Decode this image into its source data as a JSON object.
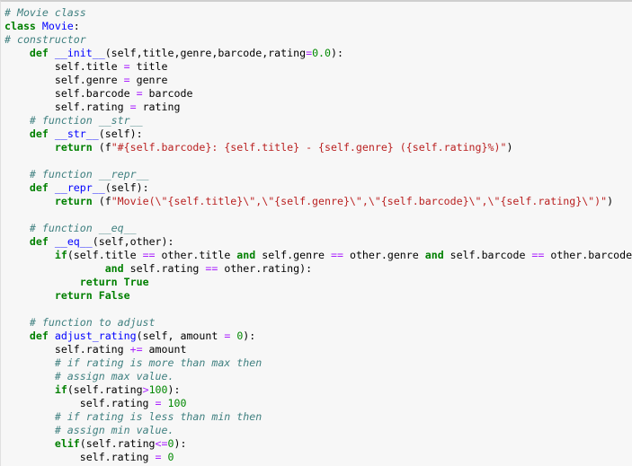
{
  "editor": {
    "language": "python",
    "colors": {
      "background": "#f7f7f7",
      "comment": "#408080",
      "keyword": "#008000",
      "definition": "#0000ff",
      "string": "#ba2121",
      "number": "#008800",
      "operator": "#aa22ff"
    },
    "lines": [
      [
        {
          "t": "comment",
          "v": "# Movie class"
        }
      ],
      [
        {
          "t": "keyword",
          "v": "class"
        },
        {
          "t": "plain",
          "v": " "
        },
        {
          "t": "def",
          "v": "Movie"
        },
        {
          "t": "plain",
          "v": ":"
        }
      ],
      [
        {
          "t": "comment",
          "v": "# constructor"
        }
      ],
      [
        {
          "t": "plain",
          "v": "    "
        },
        {
          "t": "keyword",
          "v": "def"
        },
        {
          "t": "plain",
          "v": " "
        },
        {
          "t": "def",
          "v": "__init__"
        },
        {
          "t": "plain",
          "v": "(self,title,genre,barcode,rating"
        },
        {
          "t": "op",
          "v": "="
        },
        {
          "t": "number",
          "v": "0.0"
        },
        {
          "t": "plain",
          "v": "):"
        }
      ],
      [
        {
          "t": "plain",
          "v": "        self.title "
        },
        {
          "t": "op",
          "v": "="
        },
        {
          "t": "plain",
          "v": " title"
        }
      ],
      [
        {
          "t": "plain",
          "v": "        self.genre "
        },
        {
          "t": "op",
          "v": "="
        },
        {
          "t": "plain",
          "v": " genre"
        }
      ],
      [
        {
          "t": "plain",
          "v": "        self.barcode "
        },
        {
          "t": "op",
          "v": "="
        },
        {
          "t": "plain",
          "v": " barcode"
        }
      ],
      [
        {
          "t": "plain",
          "v": "        self.rating "
        },
        {
          "t": "op",
          "v": "="
        },
        {
          "t": "plain",
          "v": " rating"
        }
      ],
      [
        {
          "t": "plain",
          "v": "    "
        },
        {
          "t": "comment",
          "v": "# function __str__"
        }
      ],
      [
        {
          "t": "plain",
          "v": "    "
        },
        {
          "t": "keyword",
          "v": "def"
        },
        {
          "t": "plain",
          "v": " "
        },
        {
          "t": "def",
          "v": "__str__"
        },
        {
          "t": "plain",
          "v": "(self):"
        }
      ],
      [
        {
          "t": "plain",
          "v": "        "
        },
        {
          "t": "keyword",
          "v": "return"
        },
        {
          "t": "plain",
          "v": " (f"
        },
        {
          "t": "string",
          "v": "\"#{self.barcode}: {self.title} - {self.genre} ({self.rating}%)\""
        },
        {
          "t": "plain",
          "v": ")"
        }
      ],
      [
        {
          "t": "plain",
          "v": ""
        }
      ],
      [
        {
          "t": "plain",
          "v": "    "
        },
        {
          "t": "comment",
          "v": "# function __repr__"
        }
      ],
      [
        {
          "t": "plain",
          "v": "    "
        },
        {
          "t": "keyword",
          "v": "def"
        },
        {
          "t": "plain",
          "v": " "
        },
        {
          "t": "def",
          "v": "__repr__"
        },
        {
          "t": "plain",
          "v": "(self):"
        }
      ],
      [
        {
          "t": "plain",
          "v": "        "
        },
        {
          "t": "keyword",
          "v": "return"
        },
        {
          "t": "plain",
          "v": " (f"
        },
        {
          "t": "string",
          "v": "\"Movie(\\\"{self.title}\\\",\\\"{self.genre}\\\",\\\"{self.barcode}\\\",\\\"{self.rating}\\\")\""
        },
        {
          "t": "plain",
          "v": ")"
        }
      ],
      [
        {
          "t": "plain",
          "v": ""
        }
      ],
      [
        {
          "t": "plain",
          "v": "    "
        },
        {
          "t": "comment",
          "v": "# function __eq__"
        }
      ],
      [
        {
          "t": "plain",
          "v": "    "
        },
        {
          "t": "keyword",
          "v": "def"
        },
        {
          "t": "plain",
          "v": " "
        },
        {
          "t": "def",
          "v": "__eq__"
        },
        {
          "t": "plain",
          "v": "(self,other):"
        }
      ],
      [
        {
          "t": "plain",
          "v": "        "
        },
        {
          "t": "keyword",
          "v": "if"
        },
        {
          "t": "plain",
          "v": "(self.title "
        },
        {
          "t": "op",
          "v": "=="
        },
        {
          "t": "plain",
          "v": " other.title "
        },
        {
          "t": "keyword",
          "v": "and"
        },
        {
          "t": "plain",
          "v": " self.genre "
        },
        {
          "t": "op",
          "v": "=="
        },
        {
          "t": "plain",
          "v": " other.genre "
        },
        {
          "t": "keyword",
          "v": "and"
        },
        {
          "t": "plain",
          "v": " self.barcode "
        },
        {
          "t": "op",
          "v": "=="
        },
        {
          "t": "plain",
          "v": " other.barcode"
        }
      ],
      [
        {
          "t": "plain",
          "v": "                "
        },
        {
          "t": "keyword",
          "v": "and"
        },
        {
          "t": "plain",
          "v": " self.rating "
        },
        {
          "t": "op",
          "v": "=="
        },
        {
          "t": "plain",
          "v": " other.rating):"
        }
      ],
      [
        {
          "t": "plain",
          "v": "            "
        },
        {
          "t": "keyword",
          "v": "return"
        },
        {
          "t": "plain",
          "v": " "
        },
        {
          "t": "keyword",
          "v": "True"
        }
      ],
      [
        {
          "t": "plain",
          "v": "        "
        },
        {
          "t": "keyword",
          "v": "return"
        },
        {
          "t": "plain",
          "v": " "
        },
        {
          "t": "keyword",
          "v": "False"
        }
      ],
      [
        {
          "t": "plain",
          "v": ""
        }
      ],
      [
        {
          "t": "plain",
          "v": "    "
        },
        {
          "t": "comment",
          "v": "# function to adjust"
        }
      ],
      [
        {
          "t": "plain",
          "v": "    "
        },
        {
          "t": "keyword",
          "v": "def"
        },
        {
          "t": "plain",
          "v": " "
        },
        {
          "t": "def",
          "v": "adjust_rating"
        },
        {
          "t": "plain",
          "v": "(self, amount "
        },
        {
          "t": "op",
          "v": "="
        },
        {
          "t": "plain",
          "v": " "
        },
        {
          "t": "number",
          "v": "0"
        },
        {
          "t": "plain",
          "v": "):"
        }
      ],
      [
        {
          "t": "plain",
          "v": "        self.rating "
        },
        {
          "t": "op",
          "v": "+="
        },
        {
          "t": "plain",
          "v": " amount"
        }
      ],
      [
        {
          "t": "plain",
          "v": "        "
        },
        {
          "t": "comment",
          "v": "# if rating is more than max then"
        }
      ],
      [
        {
          "t": "plain",
          "v": "        "
        },
        {
          "t": "comment",
          "v": "# assign max value."
        }
      ],
      [
        {
          "t": "plain",
          "v": "        "
        },
        {
          "t": "keyword",
          "v": "if"
        },
        {
          "t": "plain",
          "v": "(self.rating"
        },
        {
          "t": "op",
          "v": ">"
        },
        {
          "t": "number",
          "v": "100"
        },
        {
          "t": "plain",
          "v": "):"
        }
      ],
      [
        {
          "t": "plain",
          "v": "            self.rating "
        },
        {
          "t": "op",
          "v": "="
        },
        {
          "t": "plain",
          "v": " "
        },
        {
          "t": "number",
          "v": "100"
        }
      ],
      [
        {
          "t": "plain",
          "v": "        "
        },
        {
          "t": "comment",
          "v": "# if rating is less than min then"
        }
      ],
      [
        {
          "t": "plain",
          "v": "        "
        },
        {
          "t": "comment",
          "v": "# assign min value."
        }
      ],
      [
        {
          "t": "plain",
          "v": "        "
        },
        {
          "t": "keyword",
          "v": "elif"
        },
        {
          "t": "plain",
          "v": "(self.rating"
        },
        {
          "t": "op",
          "v": "<="
        },
        {
          "t": "number",
          "v": "0"
        },
        {
          "t": "plain",
          "v": "):"
        }
      ],
      [
        {
          "t": "plain",
          "v": "            self.rating "
        },
        {
          "t": "op",
          "v": "="
        },
        {
          "t": "plain",
          "v": " "
        },
        {
          "t": "number",
          "v": "0"
        }
      ]
    ]
  }
}
